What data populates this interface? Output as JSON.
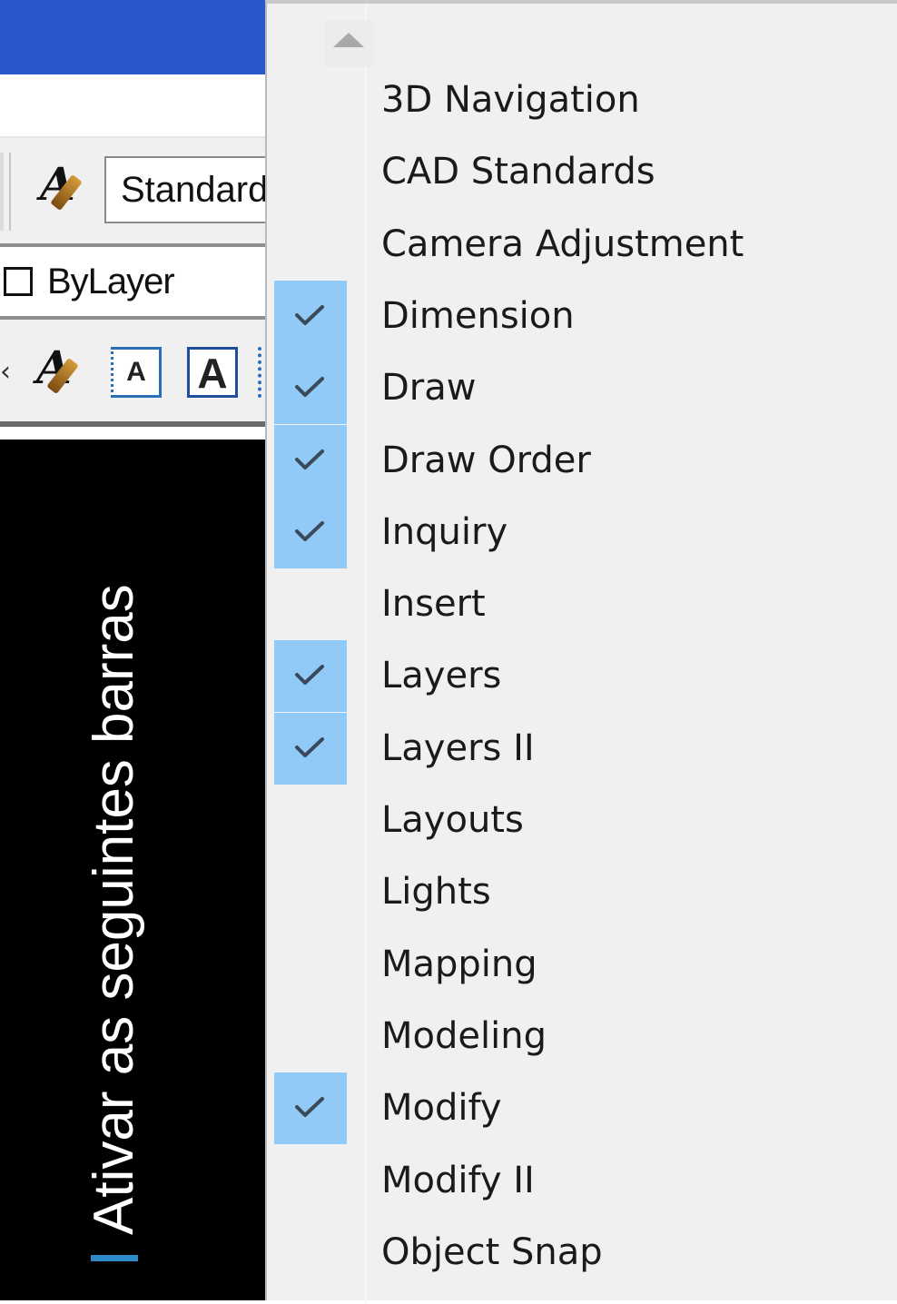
{
  "left_panel": {
    "text_style_value": "Standard",
    "color_value": "ByLayer",
    "annotation_icon_a": "A",
    "annotation_icon_b": "A",
    "slide_caption": "Ativar as seguintes barras",
    "caption_accent_color": "#2d8ac7",
    "titlebar_color": "#2b57cc"
  },
  "menu": {
    "check_highlight_color": "#91c9f7",
    "scroll_up_icon": "triangle-up-icon",
    "items": [
      {
        "label": "3D Navigation",
        "checked": false
      },
      {
        "label": "CAD Standards",
        "checked": false
      },
      {
        "label": "Camera Adjustment",
        "checked": false
      },
      {
        "label": "Dimension",
        "checked": true
      },
      {
        "label": "Draw",
        "checked": true
      },
      {
        "label": "Draw Order",
        "checked": true
      },
      {
        "label": "Inquiry",
        "checked": true
      },
      {
        "label": "Insert",
        "checked": false
      },
      {
        "label": "Layers",
        "checked": true
      },
      {
        "label": "Layers II",
        "checked": true
      },
      {
        "label": "Layouts",
        "checked": false
      },
      {
        "label": "Lights",
        "checked": false
      },
      {
        "label": "Mapping",
        "checked": false
      },
      {
        "label": "Modeling",
        "checked": false
      },
      {
        "label": "Modify",
        "checked": true
      },
      {
        "label": "Modify II",
        "checked": false
      },
      {
        "label": "Object Snap",
        "checked": false
      }
    ]
  }
}
